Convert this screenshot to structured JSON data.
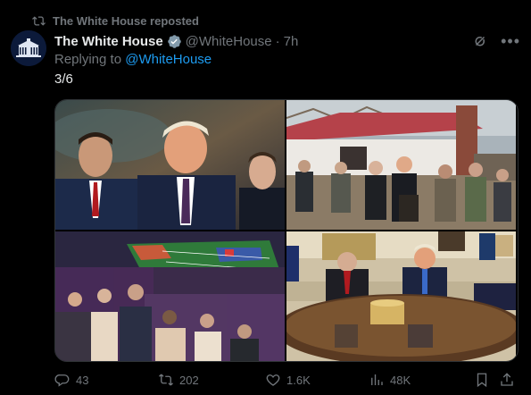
{
  "repost": {
    "text": "The White House reposted",
    "icon": "repost-icon"
  },
  "author": {
    "name": "The White House",
    "handle": "@WhiteHouse",
    "separator": "·",
    "time": "7h",
    "verified_badge": "gray-verified-badge-icon"
  },
  "reply": {
    "prefix": "Replying to",
    "target": "@WhiteHouse"
  },
  "tweet": {
    "text": "3/6"
  },
  "actions": {
    "replies": "43",
    "reposts": "202",
    "likes": "1.6K",
    "views": "48K"
  },
  "colors": {
    "background": "#000000",
    "text": "#e7e9ea",
    "muted": "#71767b",
    "link": "#1d9bf0"
  }
}
